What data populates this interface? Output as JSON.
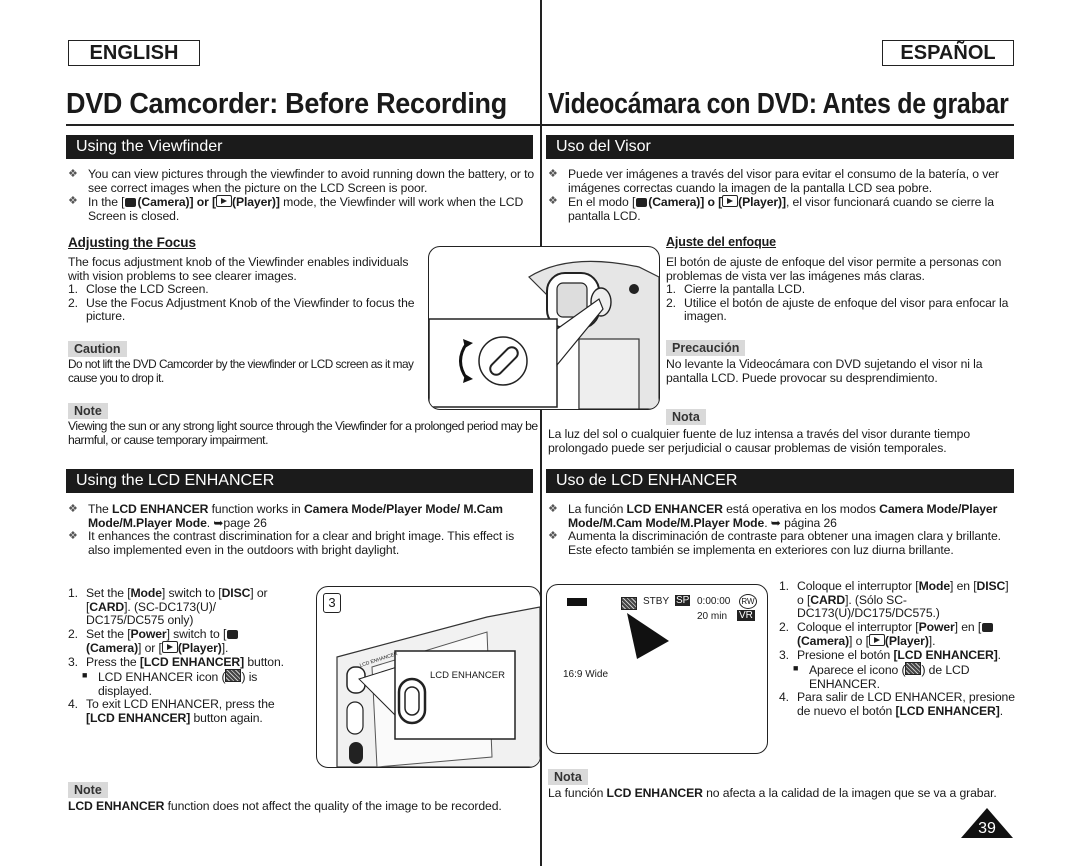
{
  "header": {
    "lang_en": "ENGLISH",
    "lang_es": "ESPAÑOL",
    "title_en": "DVD Camcorder: Before Recording",
    "title_es": "Videocámara con DVD: Antes de grabar"
  },
  "en": {
    "viewfinder": {
      "heading": "Using the Viewfinder",
      "bullets": [
        "You can view pictures through the viewfinder to avoid running down the battery, or to see correct images when the picture on the LCD Screen is poor.",
        {
          "pre": "In the [",
          "cam": "(Camera)] or [",
          "play": "(Player)] mode, the Viewfinder will work when the LCD Screen is closed."
        }
      ],
      "focus_heading": "Adjusting the Focus",
      "focus_intro": "The focus adjustment knob of the Viewfinder enables individuals with vision problems to see clearer images.",
      "steps": [
        "Close the LCD Screen.",
        "Use the Focus Adjustment Knob of the Viewfinder to focus the picture."
      ],
      "caution_label": "Caution",
      "caution_text": "Do not lift the DVD Camcorder by the viewfinder or LCD screen as it may cause you to drop it.",
      "note_label": "Note",
      "note_text": "Viewing the sun or any strong light source through the Viewfinder for a prolonged period may be harmful, or cause temporary impairment."
    },
    "enhancer": {
      "heading": "Using the LCD ENHANCER",
      "b1_a": "The ",
      "b1_b": "LCD ENHANCER",
      "b1_c": " function works in ",
      "b1_d": "Camera Mode/Player Mode/ M.Cam Mode/M.Player Mode",
      "b1_e": ". ➥page 26",
      "b2": "It enhances the contrast discrimination for a clear and bright image. This effect is also implemented even in the outdoors with bright daylight.",
      "s1_a": "Set the [",
      "s1_b": "Mode",
      "s1_c": "] switch to [",
      "s1_d": "DISC",
      "s1_e": "] or [",
      "s1_f": "CARD",
      "s1_g": "]. (SC-DC173(U)/ DC175/DC575 only)",
      "s2_a": "Set the [",
      "s2_b": "Power",
      "s2_c": "] switch to [",
      "s2_d": "(Camera)",
      "s2_e": "] or [",
      "s2_f": "(Player)",
      "s2_g": "].",
      "s3_a": "Press the ",
      "s3_b": "[LCD ENHANCER]",
      "s3_c": " button.",
      "s3_sub_a": "LCD ENHANCER icon (",
      "s3_sub_b": ") is displayed.",
      "s4_a": "To exit LCD ENHANCER, press the ",
      "s4_b": "[LCD ENHANCER]",
      "s4_c": " button again.",
      "note_label": "Note",
      "note_a": "LCD ENHANCER",
      "note_b": " function does not affect the quality of the image to be recorded."
    }
  },
  "es": {
    "viewfinder": {
      "heading": "Uso del Visor",
      "b1": "Puede ver imágenes a través del visor para evitar el consumo de la batería, o ver imágenes correctas cuando la imagen de la pantalla LCD sea pobre.",
      "b2_a": "En el modo [",
      "b2_b": "(Camera)] o [",
      "b2_c": "(Player)], el visor funcionará cuando se cierre la pantalla LCD.",
      "focus_heading": "Ajuste del enfoque",
      "focus_intro": "El botón de ajuste de enfoque del visor permite a personas con problemas de vista ver las imágenes más claras.",
      "steps": [
        "Cierre la pantalla LCD.",
        "Utilice el botón de ajuste de enfoque del visor para enfocar la imagen."
      ],
      "caution_label": "Precaución",
      "caution_text": "No levante la Videocámara con DVD sujetando el visor ni la pantalla LCD. Puede provocar su desprendimiento.",
      "note_label": "Nota",
      "note_text": "La luz del sol o cualquier fuente de luz intensa a través del visor durante tiempo prolongado puede ser perjudicial o causar problemas de visión temporales."
    },
    "enhancer": {
      "heading": "Uso de LCD ENHANCER",
      "b1_a": "La función ",
      "b1_b": "LCD ENHANCER",
      "b1_c": " está operativa en los modos ",
      "b1_d": "Camera Mode/Player Mode/M.Cam Mode/M.Player Mode",
      "b1_e": ". ➥ página 26",
      "b2": "Aumenta la discriminación de contraste para obtener una imagen clara y brillante. Este efecto también se implementa en exteriores con luz diurna brillante.",
      "s1_a": "Coloque el interruptor [",
      "s1_b": "Mode",
      "s1_c": "] en [",
      "s1_d": "DISC",
      "s1_e": "] o [",
      "s1_f": "CARD",
      "s1_g": "]. (Sólo SC-DC173(U)/DC175/DC575.)",
      "s2_a": "Coloque el interruptor [",
      "s2_b": "Power",
      "s2_c": "] en [",
      "s2_d": "(Camera)",
      "s2_e": "] o [",
      "s2_f": "(Player)",
      "s2_g": "].",
      "s3_a": "Presione el botón ",
      "s3_b": "[LCD ENHANCER]",
      "s3_c": ".",
      "s3_sub_a": "Aparece el icono (",
      "s3_sub_b": ") de LCD ENHANCER.",
      "s4_a": "Para salir de LCD ENHANCER, presione de nuevo el botón ",
      "s4_b": "[LCD ENHANCER]",
      "s4_c": ".",
      "note_label": "Nota",
      "note_a": "La función ",
      "note_b": "LCD ENHANCER",
      "note_c": " no afecta a la calidad de la imagen que se va a grabar."
    }
  },
  "figures": {
    "step_badge": "3",
    "button_callout": "LCD ENHANCER",
    "body_label": "LCD ENHANCER",
    "screen": {
      "status": "STBY",
      "quality": "SP",
      "timecode": "0:00:00",
      "disc": "RW",
      "remaining": "20 min",
      "format": "VR",
      "aspect": "16:9 Wide"
    }
  },
  "page_number": "39"
}
